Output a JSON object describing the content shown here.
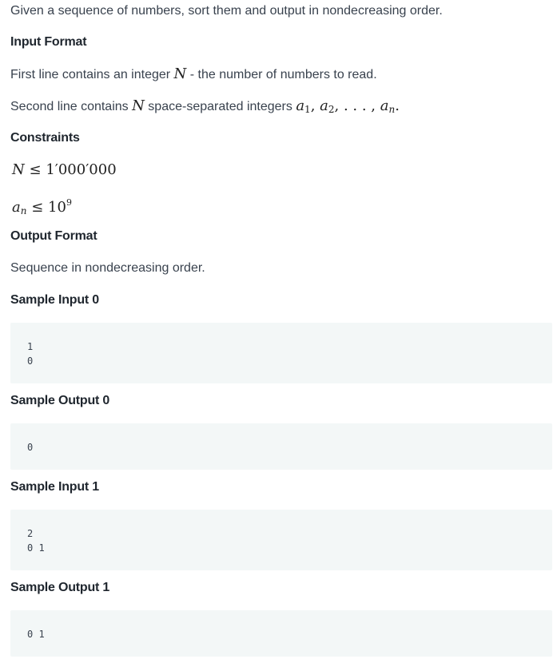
{
  "problem": {
    "description": "Given a sequence of numbers, sort them and output in nondecreasing order.",
    "input_format": {
      "heading": "Input Format",
      "line1_before": "First line contains an integer ",
      "line1_var": "N",
      "line1_after": " - the number of numbers to read.",
      "line2_before": "Second line contains ",
      "line2_var": "N",
      "line2_after": " space-separated integers "
    },
    "constraints": {
      "heading": "Constraints",
      "c1_lhs": "N",
      "c1_op": "≤",
      "c1_rhs": "1′000′000",
      "c2_lhs": "a",
      "c2_sub": "n",
      "c2_op": "≤",
      "c2_base": "10",
      "c2_exp": "9"
    },
    "output_format": {
      "heading": "Output Format",
      "text": "Sequence in nondecreasing order."
    }
  },
  "samples": {
    "input0": {
      "heading": "Sample Input 0",
      "lines": [
        "1",
        "0"
      ]
    },
    "output0": {
      "heading": "Sample Output 0",
      "lines": [
        "0"
      ]
    },
    "input1": {
      "heading": "Sample Input 1",
      "lines": [
        "2",
        "0 1"
      ]
    },
    "output1": {
      "heading": "Sample Output 1",
      "lines": [
        "0 1"
      ]
    }
  }
}
